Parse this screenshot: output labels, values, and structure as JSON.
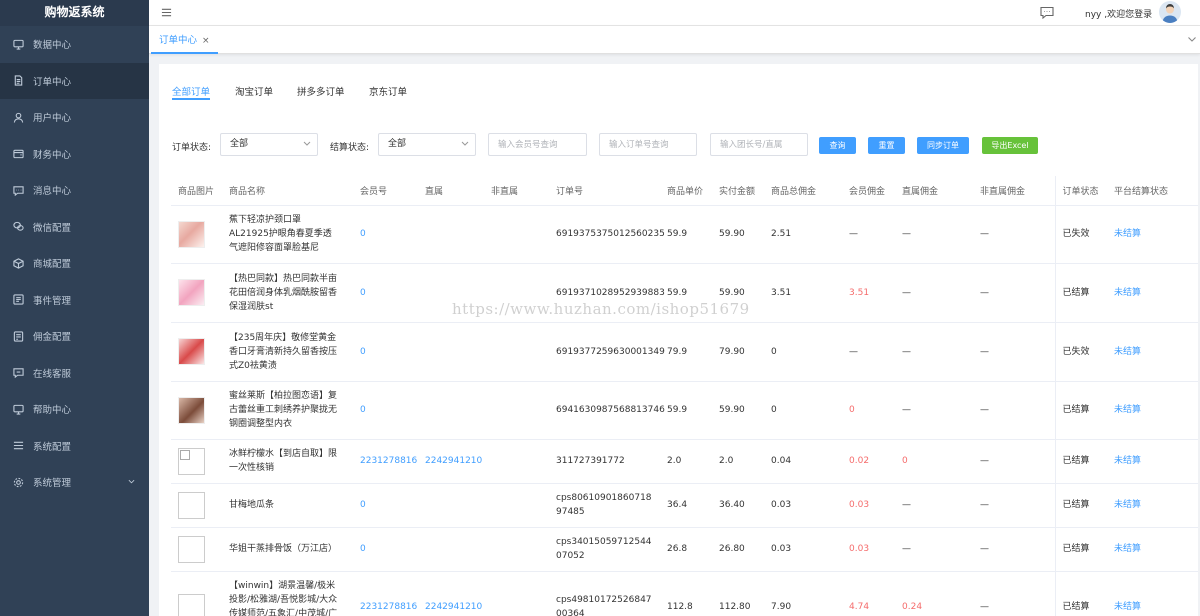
{
  "app": {
    "title": "购物返系统"
  },
  "sidebar": {
    "items": [
      {
        "label": "数据中心",
        "icon": "dashboard-icon"
      },
      {
        "label": "订单中心",
        "icon": "order-icon"
      },
      {
        "label": "用户中心",
        "icon": "user-icon"
      },
      {
        "label": "财务中心",
        "icon": "finance-icon"
      },
      {
        "label": "消息中心",
        "icon": "message-icon"
      },
      {
        "label": "微信配置",
        "icon": "wechat-icon"
      },
      {
        "label": "商城配置",
        "icon": "mall-icon"
      },
      {
        "label": "事件管理",
        "icon": "event-icon"
      },
      {
        "label": "佣金配置",
        "icon": "commission-icon"
      },
      {
        "label": "在线客服",
        "icon": "service-icon"
      },
      {
        "label": "帮助中心",
        "icon": "help-icon"
      },
      {
        "label": "系统配置",
        "icon": "list-icon"
      },
      {
        "label": "系统管理",
        "icon": "gear-icon"
      }
    ]
  },
  "header": {
    "welcome": "nyy ,欢迎您登录"
  },
  "tabs": {
    "active_label": "订单中心",
    "close_glyph": "×"
  },
  "subtabs": [
    "全部订单",
    "淘宝订单",
    "拼多多订单",
    "京东订单"
  ],
  "filters": {
    "order_status_label": "订单状态:",
    "order_status_value": "全部",
    "settle_status_label": "结算状态:",
    "settle_status_value": "全部",
    "member_placeholder": "输入会员号查询",
    "order_placeholder": "输入订单号查询",
    "leader_placeholder": "输入团长号/直属",
    "btn_query": "查询",
    "btn_reset": "重置",
    "btn_sync": "同步订单",
    "btn_export": "导出Excel"
  },
  "table": {
    "headers": [
      "商品图片",
      "商品名称",
      "会员号",
      "直属",
      "非直属",
      "订单号",
      "商品单价",
      "实付金额",
      "商品总佣金",
      "会员佣金",
      "直属佣金",
      "非直属佣金",
      "订单状态",
      "平台结算状态"
    ],
    "rows": [
      {
        "name": "蕉下轻凉护颈口罩AL21925护眼角春夏季透气遮阳修容面罩脸基尼",
        "member": "0",
        "direct": "",
        "indirect": "",
        "order_no": "6919375375012560235",
        "price": "59.9",
        "paid": "59.90",
        "total_comm": "2.51",
        "member_comm": "—",
        "direct_comm": "—",
        "indirect_comm": "—",
        "status": "已失效",
        "settle": "未结算"
      },
      {
        "name": "【热巴同款】热巴同款半亩花田倍润身体乳烟酰胺留香保湿润肤st",
        "member": "0",
        "direct": "",
        "indirect": "",
        "order_no": "6919371028952939883",
        "price": "59.9",
        "paid": "59.90",
        "total_comm": "3.51",
        "member_comm": "3.51",
        "direct_comm": "—",
        "indirect_comm": "—",
        "status": "已结算",
        "settle": "未结算"
      },
      {
        "name": "【235周年庆】敬修堂黄金香口牙膏清新持久留香按压式Z0祛黄渍",
        "member": "0",
        "direct": "",
        "indirect": "",
        "order_no": "6919377259630001349",
        "price": "79.9",
        "paid": "79.90",
        "total_comm": "0",
        "member_comm": "—",
        "direct_comm": "—",
        "indirect_comm": "—",
        "status": "已失效",
        "settle": "未结算"
      },
      {
        "name": "蜜丝莱斯【柏拉图恋语】复古蕾丝重工刺绣养护聚拢无钢圈调整型内衣",
        "member": "0",
        "direct": "",
        "indirect": "",
        "order_no": "6941630987568813746",
        "price": "59.9",
        "paid": "59.90",
        "total_comm": "0",
        "member_comm": "0",
        "direct_comm": "—",
        "indirect_comm": "—",
        "status": "已结算",
        "settle": "未结算"
      },
      {
        "name": "冰鲜柠檬水【到店自取】限一次性核销",
        "member": "2231278816",
        "direct": "2242941210",
        "indirect": "",
        "order_no": "311727391772",
        "price": "2.0",
        "paid": "2.0",
        "total_comm": "0.04",
        "member_comm": "0.02",
        "direct_comm": "0",
        "indirect_comm": "—",
        "status": "已结算",
        "settle": "未结算"
      },
      {
        "name": "甘梅地瓜条",
        "member": "0",
        "direct": "",
        "indirect": "",
        "order_no": "cps8061090186071897485",
        "price": "36.4",
        "paid": "36.40",
        "total_comm": "0.03",
        "member_comm": "0.03",
        "direct_comm": "—",
        "indirect_comm": "—",
        "status": "已结算",
        "settle": "未结算"
      },
      {
        "name": "华姐干蒸排骨饭（万江店）",
        "member": "0",
        "direct": "",
        "indirect": "",
        "order_no": "cps3401505971254407052",
        "price": "26.8",
        "paid": "26.80",
        "total_comm": "0.03",
        "member_comm": "0.03",
        "direct_comm": "—",
        "indirect_comm": "—",
        "status": "已结算",
        "settle": "未结算"
      },
      {
        "name": "【winwin】湖景温馨/极米投影/松雅湖/吾悦影城/大众传媒师范/五象汇/中茂城/广电/世",
        "member": "2231278816",
        "direct": "2242941210",
        "indirect": "",
        "order_no": "cps4981017252684700364",
        "price": "112.8",
        "paid": "112.80",
        "total_comm": "7.90",
        "member_comm": "4.74",
        "direct_comm": "0.24",
        "indirect_comm": "—",
        "status": "已结算",
        "settle": "未结算"
      }
    ]
  },
  "watermark": "https://www.huzhan.com/ishop51679",
  "colors": {
    "sidebar_bg": "#304156",
    "primary": "#409eff",
    "success": "#67c23a",
    "danger": "#f56c6c"
  }
}
